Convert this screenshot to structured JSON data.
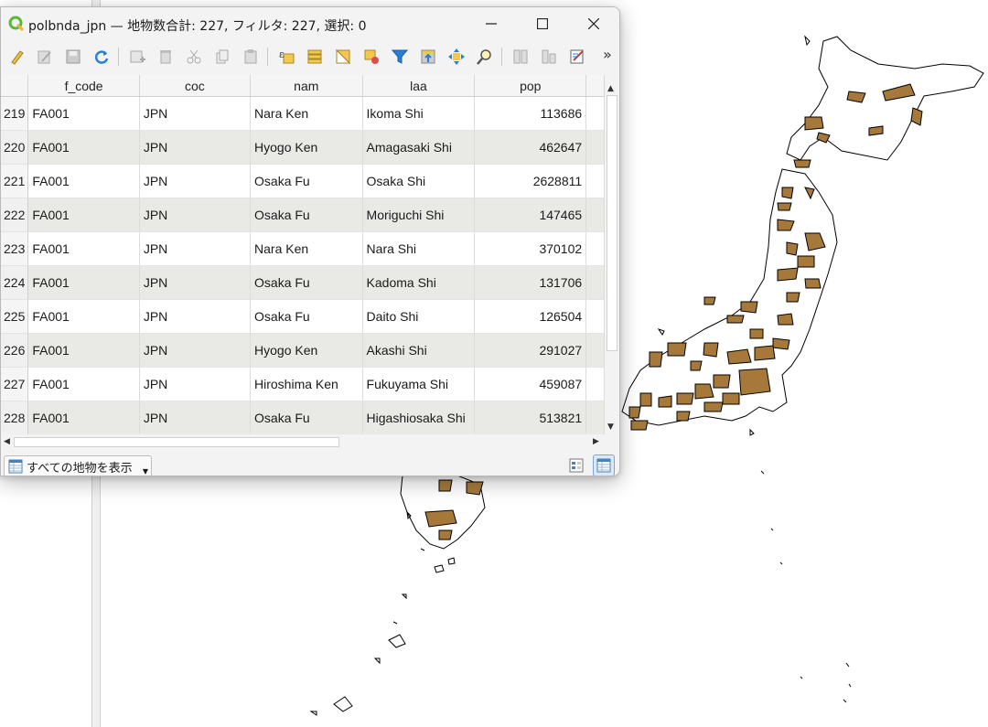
{
  "window": {
    "title": "polbnda_jpn — 地物数合計: 227, フィルタ: 227, 選択: 0",
    "controls": {
      "minimize_icon": "window-minimize-icon",
      "maximize_icon": "window-maximize-icon",
      "close_icon": "window-close-icon"
    }
  },
  "toolbar": {
    "icons": [
      "edit-pencil-icon",
      "multi-edit-icon",
      "save-edits-icon",
      "reload-icon",
      "add-feature-icon",
      "delete-feature-icon",
      "cut-icon",
      "copy-icon",
      "paste-icon",
      "expression-select-icon",
      "select-all-icon",
      "invert-selection-icon",
      "deselect-icon",
      "filter-icon",
      "move-selection-top-icon",
      "pan-to-selected-icon",
      "zoom-to-selected-icon",
      "new-field-icon",
      "delete-field-icon",
      "field-calculator-icon"
    ],
    "overflow": "»"
  },
  "table": {
    "columns": [
      "f_code",
      "coc",
      "nam",
      "laa",
      "pop"
    ],
    "rows": [
      {
        "id": "219",
        "f_code": "FA001",
        "coc": "JPN",
        "nam": "Nara Ken",
        "laa": "Ikoma Shi",
        "pop": "113686"
      },
      {
        "id": "220",
        "f_code": "FA001",
        "coc": "JPN",
        "nam": "Hyogo Ken",
        "laa": "Amagasaki Shi",
        "pop": "462647"
      },
      {
        "id": "221",
        "f_code": "FA001",
        "coc": "JPN",
        "nam": "Osaka Fu",
        "laa": "Osaka Shi",
        "pop": "2628811"
      },
      {
        "id": "222",
        "f_code": "FA001",
        "coc": "JPN",
        "nam": "Osaka Fu",
        "laa": "Moriguchi Shi",
        "pop": "147465"
      },
      {
        "id": "223",
        "f_code": "FA001",
        "coc": "JPN",
        "nam": "Nara Ken",
        "laa": "Nara Shi",
        "pop": "370102"
      },
      {
        "id": "224",
        "f_code": "FA001",
        "coc": "JPN",
        "nam": "Osaka Fu",
        "laa": "Kadoma Shi",
        "pop": "131706"
      },
      {
        "id": "225",
        "f_code": "FA001",
        "coc": "JPN",
        "nam": "Osaka Fu",
        "laa": "Daito Shi",
        "pop": "126504"
      },
      {
        "id": "226",
        "f_code": "FA001",
        "coc": "JPN",
        "nam": "Hyogo Ken",
        "laa": "Akashi Shi",
        "pop": "291027"
      },
      {
        "id": "227",
        "f_code": "FA001",
        "coc": "JPN",
        "nam": "Hiroshima Ken",
        "laa": "Fukuyama Shi",
        "pop": "459087"
      },
      {
        "id": "228",
        "f_code": "FA001",
        "coc": "JPN",
        "nam": "Osaka Fu",
        "laa": "Higashiosaka Shi",
        "pop": "513821"
      }
    ]
  },
  "bottom": {
    "filter_label": "すべての地物を表示",
    "view_buttons": [
      "form-view-icon",
      "table-view-icon"
    ]
  },
  "map": {
    "fill_color": "#a6793a",
    "outline_color": "#000000"
  }
}
